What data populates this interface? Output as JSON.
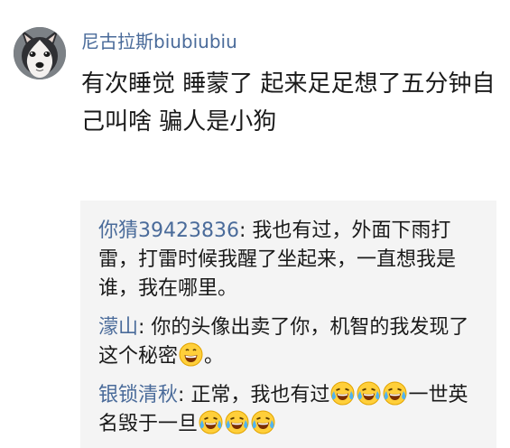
{
  "post": {
    "author": "尼古拉斯biubiubiu",
    "text": "有次睡觉 睡蒙了 起来足足想了五分钟自己叫啥 骗人是小狗"
  },
  "replies": [
    {
      "author": "你猜39423836",
      "sep": ": ",
      "text": "我也有过，外面下雨打雷，打雷时候我醒了坐起来，一直想我是谁，我在哪里。"
    },
    {
      "author": "濛山",
      "sep": ": ",
      "text_before": "你的头像出卖了你，机智的我发现了这个秘密",
      "emoji": "grinning-emoji",
      "text_after": "。"
    },
    {
      "author": "银锁清秋",
      "sep": ": ",
      "text_before": "正常，我也有过",
      "emoji": "laughing-crying-emoji",
      "text_middle": "一世英名毁于一旦"
    }
  ]
}
